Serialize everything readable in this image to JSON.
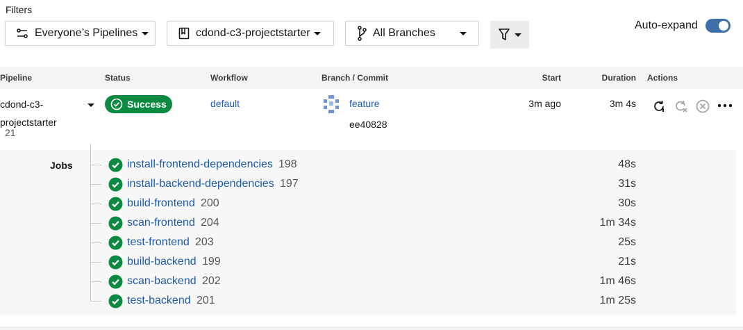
{
  "filters": {
    "label": "Filters",
    "pipelines_filter": "Everyone’s Pipelines",
    "project_filter": "cdond-c3-projectstarter",
    "branch_filter": "All Branches",
    "funnel_icon": "filter-funnel-icon"
  },
  "auto_expand": {
    "label": "Auto-expand",
    "enabled": true
  },
  "table": {
    "headers": {
      "pipeline": "Pipeline",
      "status": "Status",
      "workflow": "Workflow",
      "branch_commit": "Branch / Commit",
      "start": "Start",
      "duration": "Duration",
      "actions": "Actions"
    }
  },
  "pipeline_row": {
    "name_line1": "cdond-c3-",
    "name_line2": "projectstarter",
    "number": "21",
    "status": "Success",
    "workflow": "default",
    "branch": "feature",
    "commit": "ee40828",
    "start": "3m ago",
    "duration": "3m 4s"
  },
  "jobs": {
    "label": "Jobs",
    "items": [
      {
        "name": "install-frontend-dependencies",
        "number": "198",
        "duration": "48s"
      },
      {
        "name": "install-backend-dependencies",
        "number": "197",
        "duration": "31s"
      },
      {
        "name": "build-frontend",
        "number": "200",
        "duration": "30s"
      },
      {
        "name": "scan-frontend",
        "number": "204",
        "duration": "1m 34s"
      },
      {
        "name": "test-frontend",
        "number": "203",
        "duration": "25s"
      },
      {
        "name": "build-backend",
        "number": "199",
        "duration": "21s"
      },
      {
        "name": "scan-backend",
        "number": "202",
        "duration": "1m 46s"
      },
      {
        "name": "test-backend",
        "number": "201",
        "duration": "1m 25s"
      }
    ]
  },
  "colors": {
    "success": "#0b8a42",
    "link": "#1e5aa8",
    "toggle": "#3e6fa8"
  }
}
